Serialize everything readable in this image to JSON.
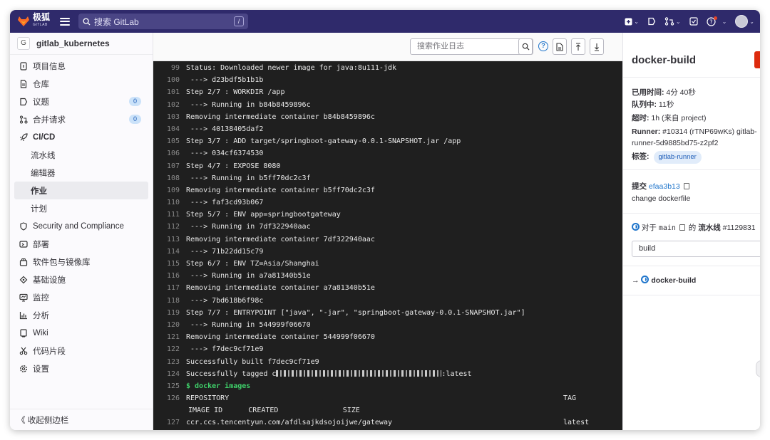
{
  "navbar": {
    "brand": "极狐",
    "brand_sub": "GITLAB",
    "search_placeholder": "搜索 GitLab",
    "search_shortcut": "/"
  },
  "sidebar": {
    "project_initial": "G",
    "project_name": "gitlab_kubernetes",
    "items": [
      {
        "label": "项目信息",
        "icon": "info-icon"
      },
      {
        "label": "仓库",
        "icon": "doc-icon"
      },
      {
        "label": "议题",
        "icon": "issues-icon",
        "badge": "0"
      },
      {
        "label": "合并请求",
        "icon": "merge-request-icon",
        "badge": "0"
      },
      {
        "label": "CI/CD",
        "icon": "rocket-icon"
      },
      {
        "label": "流水线"
      },
      {
        "label": "编辑器"
      },
      {
        "label": "作业"
      },
      {
        "label": "计划"
      },
      {
        "label": "Security and Compliance",
        "icon": "shield-icon"
      },
      {
        "label": "部署",
        "icon": "deploy-icon"
      },
      {
        "label": "软件包与镜像库",
        "icon": "package-icon"
      },
      {
        "label": "基础设施",
        "icon": "cloud-icon"
      },
      {
        "label": "监控",
        "icon": "monitor-icon"
      },
      {
        "label": "分析",
        "icon": "chart-icon"
      },
      {
        "label": "Wiki",
        "icon": "book-icon"
      },
      {
        "label": "代码片段",
        "icon": "scissors-icon"
      },
      {
        "label": "设置",
        "icon": "gear-icon"
      }
    ],
    "collapse_label": "《 收起侧边栏"
  },
  "log": {
    "search_placeholder": "搜索作业日志",
    "lines": [
      {
        "n": "99",
        "t": "Status: Downloaded newer image for java:8u111-jdk"
      },
      {
        "n": "100",
        "t": " ---> d23bdf5b1b1b"
      },
      {
        "n": "101",
        "t": "Step 2/7 : WORKDIR /app"
      },
      {
        "n": "102",
        "t": " ---> Running in b84b8459896c"
      },
      {
        "n": "103",
        "t": "Removing intermediate container b84b8459896c"
      },
      {
        "n": "104",
        "t": " ---> 40138405daf2"
      },
      {
        "n": "105",
        "t": "Step 3/7 : ADD target/springboot-gateway-0.0.1-SNAPSHOT.jar /app"
      },
      {
        "n": "106",
        "t": " ---> 034cf6374530"
      },
      {
        "n": "107",
        "t": "Step 4/7 : EXPOSE 8080"
      },
      {
        "n": "108",
        "t": " ---> Running in b5ff70dc2c3f"
      },
      {
        "n": "109",
        "t": "Removing intermediate container b5ff70dc2c3f"
      },
      {
        "n": "110",
        "t": " ---> faf3cd93b067"
      },
      {
        "n": "111",
        "t": "Step 5/7 : ENV app=springbootgateway"
      },
      {
        "n": "112",
        "t": " ---> Running in 7df322940aac"
      },
      {
        "n": "113",
        "t": "Removing intermediate container 7df322940aac"
      },
      {
        "n": "114",
        "t": " ---> 71b22dd15c79"
      },
      {
        "n": "115",
        "t": "Step 6/7 : ENV TZ=Asia/Shanghai"
      },
      {
        "n": "116",
        "t": " ---> Running in a7a81340b51e"
      },
      {
        "n": "117",
        "t": "Removing intermediate container a7a81340b51e"
      },
      {
        "n": "118",
        "t": " ---> 7bd618b6f98c"
      },
      {
        "n": "119",
        "t": "Step 7/7 : ENTRYPOINT [\"java\", \"-jar\", \"springboot-gateway-0.0.1-SNAPSHOT.jar\"]"
      },
      {
        "n": "120",
        "t": " ---> Running in 544999f06670"
      },
      {
        "n": "121",
        "t": "Removing intermediate container 544999f06670"
      },
      {
        "n": "122",
        "t": " ---> f7dec9cf71e9"
      },
      {
        "n": "123",
        "t": "Successfully built f7dec9cf71e9"
      }
    ],
    "tagged": {
      "n": "124",
      "prefix": "Successfully tagged c",
      "suffix": ":latest"
    },
    "cmd": {
      "n": "125",
      "t": "$ docker images"
    },
    "header1": {
      "n": "126",
      "t": "REPOSITORY",
      "tag": "TAG"
    },
    "header2": {
      "t": "IMAGE ID      CREATED               SIZE"
    },
    "row": {
      "n": "127",
      "t": "ccr.ccs.tencentyun.com/afdlsajkdsojoijwe/gateway",
      "tag": "latest"
    }
  },
  "job": {
    "title": "docker-build",
    "elapsed_label": "已用时间:",
    "elapsed": "4分 40秒",
    "queued_label": "队列中:",
    "queued": "11秒",
    "timeout_label": "超时:",
    "timeout": "1h (来自 project)",
    "runner_label": "Runner:",
    "runner": "#10314 (rTNP69wKs) gitlab-",
    "runner2": "runner-5d9885bd75-z2pf2",
    "tags_label": "标签:",
    "tag": "gitlab-runner",
    "commit_label": "提交",
    "commit": "efaa3b13",
    "commit_msg": "change dockerfile",
    "pipeline_for": "对于",
    "branch": "main",
    "pipeline_of": "的",
    "pipeline_label": "流水线",
    "pipeline_id": "#1129831",
    "stage": "build",
    "current_job": "docker-build"
  }
}
